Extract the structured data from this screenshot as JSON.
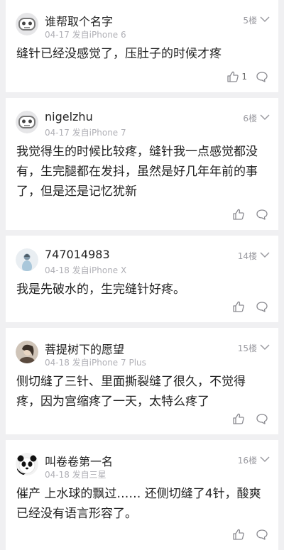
{
  "comments": [
    {
      "user": "谁帮取个名字",
      "meta": "04-17 发自iPhone 6",
      "floor": "5楼",
      "text": "缝针已经没感觉了，压肚子的时候才疼",
      "likes": "1",
      "avatar_icon": "robot-avatar-icon"
    },
    {
      "user": "nigelzhu",
      "meta": "04-17 发自iPhone 7",
      "floor": "6楼",
      "text": "我觉得生的时候比较疼，缝针我一点感觉都没有，生完腿都在发抖，虽然是好几年年前的事了，但是还是记忆犹新",
      "likes": "",
      "avatar_icon": "robot-avatar-icon"
    },
    {
      "user": "747014983",
      "meta": "04-18 发自iPhone X",
      "floor": "14楼",
      "text": "我是先破水的，生完缝针好疼。",
      "likes": "",
      "avatar_icon": "photo-avatar-icon"
    },
    {
      "user": "菩提树下的愿望",
      "meta": "04-18 发自iPhone 7 Plus",
      "floor": "15楼",
      "text": "侧切缝了三针、里面撕裂缝了很久，不觉得疼，因为宫缩疼了一天，太特么疼了",
      "likes": "",
      "avatar_icon": "photo-avatar-icon"
    },
    {
      "user": "叫卷卷第一名",
      "meta": "04-18 发自三星",
      "floor": "16楼",
      "text": "催产 上水球的飘过…… 还侧切缝了4针，酸爽已经没有语言形容了。",
      "likes": "",
      "avatar_icon": "panda-avatar-icon"
    }
  ],
  "colors": {
    "background": "#f0f0f2",
    "card": "#ffffff",
    "meta": "#b0b0b6",
    "icon": "#8a8a90"
  }
}
